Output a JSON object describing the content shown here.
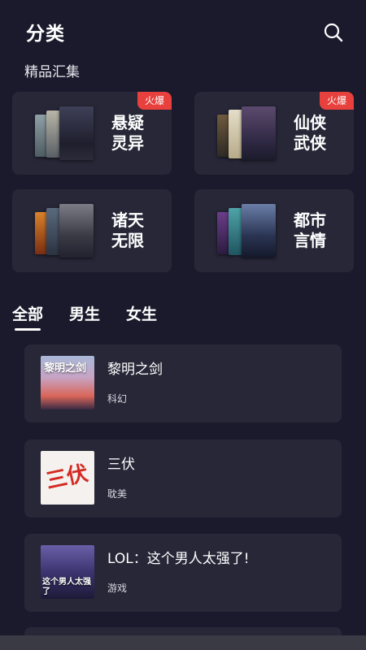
{
  "header": {
    "title": "分类",
    "search_icon": "search-icon"
  },
  "featured": {
    "label": "精品汇集",
    "categories": [
      {
        "name_line1": "悬疑",
        "name_line2": "灵异",
        "badge": "火爆"
      },
      {
        "name_line1": "仙侠",
        "name_line2": "武侠",
        "badge": "火爆"
      },
      {
        "name_line1": "诸天",
        "name_line2": "无限",
        "badge": ""
      },
      {
        "name_line1": "都市",
        "name_line2": "言情",
        "badge": ""
      }
    ]
  },
  "tabs": [
    {
      "label": "全部",
      "active": true
    },
    {
      "label": "男生",
      "active": false
    },
    {
      "label": "女生",
      "active": false
    }
  ],
  "books": [
    {
      "title": "黎明之剑",
      "tag": "科幻",
      "cover_text": "黎明之剑"
    },
    {
      "title": "三伏",
      "tag": "耽美",
      "cover_text": "三伏"
    },
    {
      "title": "LOL：这个男人太强了!",
      "tag": "游戏",
      "cover_text": "这个男人太强了"
    }
  ],
  "colors": {
    "background": "#1a1a2c",
    "card": "#272738",
    "badge": "#e8403c",
    "text": "#ffffff"
  }
}
